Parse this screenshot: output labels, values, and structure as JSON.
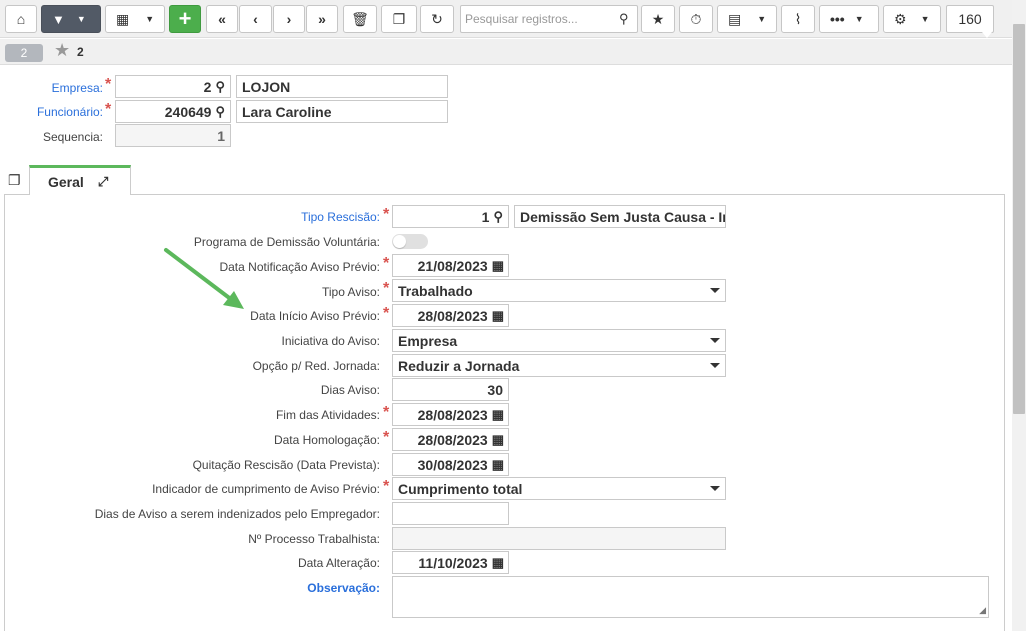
{
  "toolbar": {
    "search_placeholder": "Pesquisar registros...",
    "counter": "160"
  },
  "record": {
    "tab": "2",
    "number": "2"
  },
  "header": {
    "empresa_label": "Empresa:",
    "empresa_code": "2",
    "empresa_name": "LOJON",
    "funcionario_label": "Funcionário:",
    "funcionario_code": "240649",
    "funcionario_name": "Lara Caroline",
    "sequencia_label": "Sequencia:",
    "sequencia_value": "1"
  },
  "tab": {
    "label": "Geral"
  },
  "form": {
    "tipo_rescisao_label": "Tipo Rescisão:",
    "tipo_rescisao_code": "1",
    "tipo_rescisao_desc": "Demissão Sem Justa Causa - Iniciativa",
    "pdv_label": "Programa de Demissão Voluntária:",
    "data_notificacao_label": "Data Notificação Aviso Prévio:",
    "data_notificacao_value": "21/08/2023",
    "tipo_aviso_label": "Tipo Aviso:",
    "tipo_aviso_value": "Trabalhado",
    "data_inicio_label": "Data Início Aviso Prévio:",
    "data_inicio_value": "28/08/2023",
    "iniciativa_label": "Iniciativa do Aviso:",
    "iniciativa_value": "Empresa",
    "opcao_label": "Opção p/ Red. Jornada:",
    "opcao_value": "Reduzir a Jornada",
    "dias_aviso_label": "Dias Aviso:",
    "dias_aviso_value": "30",
    "fim_atividades_label": "Fim das Atividades:",
    "fim_atividades_value": "28/08/2023",
    "data_homologacao_label": "Data Homologação:",
    "data_homologacao_value": "28/08/2023",
    "quitacao_label": "Quitação Rescisão (Data Prevista):",
    "quitacao_value": "30/08/2023",
    "indicador_label": "Indicador de cumprimento de Aviso Prévio:",
    "indicador_value": "Cumprimento total",
    "dias_indenizados_label": "Dias de Aviso a serem indenizados pelo Empregador:",
    "dias_indenizados_value": "",
    "processo_label": "Nº Processo Trabalhista:",
    "processo_value": "",
    "data_alteracao_label": "Data Alteração:",
    "data_alteracao_value": "11/10/2023",
    "observacao_label": "Observação:"
  },
  "colors": {
    "accent_blue": "#2a6fdb",
    "required_red": "#d9534f",
    "tab_green": "#5cb85c",
    "arrow_green": "#5cb85c"
  }
}
